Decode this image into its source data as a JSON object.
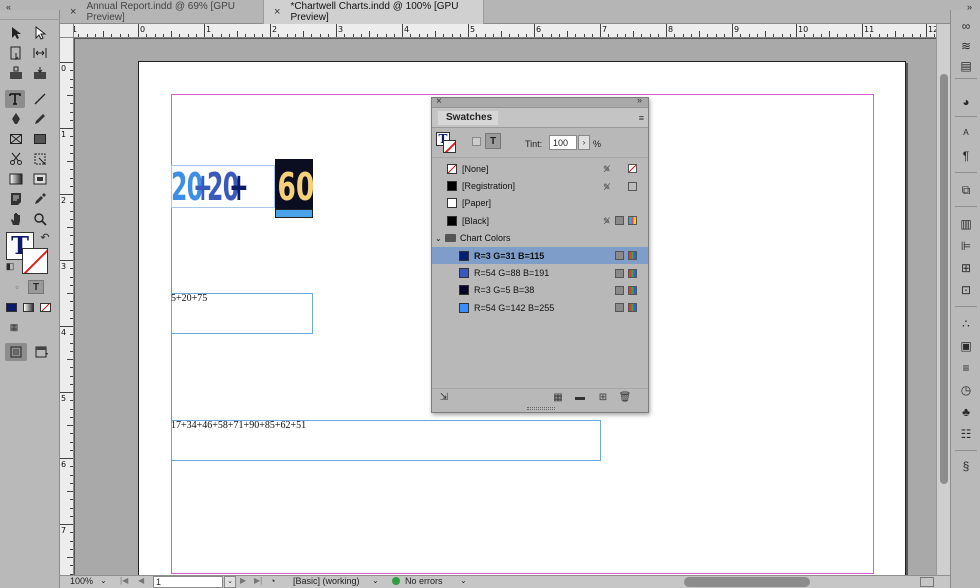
{
  "tabs": [
    {
      "label": "Annual Report.indd @ 69% [GPU Preview]",
      "active": false
    },
    {
      "label": "*Chartwell Charts.indd @ 100% [GPU Preview]",
      "active": true
    }
  ],
  "ruler": {
    "h_ticks": [
      "1",
      "0",
      "1",
      "2",
      "3",
      "4",
      "5",
      "6",
      "7",
      "8",
      "9",
      "10",
      "11",
      "12"
    ],
    "v_ticks": [
      "0",
      "1",
      "2",
      "3",
      "4",
      "5",
      "6",
      "7"
    ]
  },
  "document": {
    "chart_heading": {
      "parts": [
        "20",
        "+",
        "20",
        "+"
      ],
      "highlighted": "60"
    },
    "text_frames": [
      {
        "content": "5+20+75"
      },
      {
        "content": "17+34+46+58+71+90+85+62+51"
      }
    ],
    "colors": {
      "margin_guide": "#d35fd3",
      "frame": "#6aa9e0",
      "bar_1": "#3d8ee6",
      "bar_2": "#3b58bb",
      "bar_3": "#0a1a68",
      "bar_4_bg": "#0b0d20",
      "bar_4_text": "#f5cf7a"
    }
  },
  "swatches_panel": {
    "title": "Swatches",
    "tint_label": "Tint:",
    "tint_value": "100",
    "tint_unit": "%",
    "rows": [
      {
        "label": "[None]",
        "chip": "none",
        "icons": [
          "no-edit",
          "none-mode"
        ]
      },
      {
        "label": "[Registration]",
        "chip": "#000000",
        "icons": [
          "no-edit",
          "registration"
        ]
      },
      {
        "label": "[Paper]",
        "chip": "#ffffff",
        "icons": []
      },
      {
        "label": "[Black]",
        "chip": "#000000",
        "icons": [
          "no-edit",
          "process",
          "cmyk"
        ]
      }
    ],
    "group": {
      "label": "Chart Colors",
      "items": [
        {
          "label": "R=3 G=31 B=115",
          "chip": "#031f73",
          "selected": true
        },
        {
          "label": "R=54 G=88 B=191",
          "chip": "#3658bf",
          "selected": false
        },
        {
          "label": "R=3 G=5 B=38",
          "chip": "#030526",
          "selected": false
        },
        {
          "label": "R=54 G=142 B=255",
          "chip": "#368eff",
          "selected": false
        }
      ]
    },
    "footer_buttons": [
      "import-icon",
      "color-group-icon",
      "folder-icon",
      "new-swatch-icon",
      "trash-icon"
    ]
  },
  "status_bar": {
    "zoom": "100%",
    "page": "1",
    "profile": "[Basic] (working)",
    "preflight": "No errors"
  },
  "tools": {
    "fill_color": "#0b1a6b",
    "stroke": "none"
  }
}
